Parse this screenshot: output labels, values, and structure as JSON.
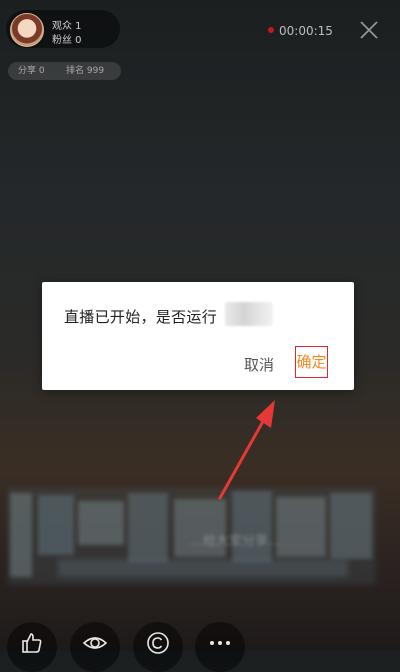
{
  "host": {
    "viewers_label": "观众 1",
    "fans_label": "粉丝 0"
  },
  "stats": {
    "score_label": "分享 0",
    "rank_label": "排名 999"
  },
  "timer": "00:00:15",
  "dialog": {
    "message": "直播已开始，是否运行",
    "cancel_label": "取消",
    "confirm_label": "确定"
  },
  "banner": {
    "blurred_text": "…给大家分享…"
  },
  "colors": {
    "accent": "#f08a24",
    "highlight_border": "#e02828",
    "rec_dot": "#c0191f",
    "arrow": "#e53935"
  },
  "toolbar": {
    "icons": [
      "thumbs-up-icon",
      "eye-icon",
      "copyright-icon",
      "more-icon"
    ]
  }
}
